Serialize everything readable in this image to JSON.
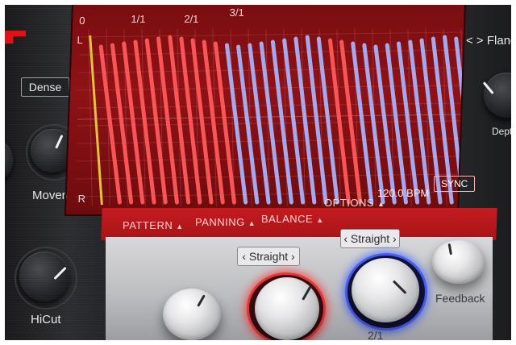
{
  "display": {
    "time_markers": [
      "0",
      "1/1",
      "2/1",
      "3/1"
    ],
    "channel_left": "L",
    "channel_right": "R",
    "colors": {
      "bar_red": "#ff5a5a",
      "bar_blue": "#a9b6ff",
      "playhead": "#e6c23a"
    }
  },
  "left_panel": {
    "mode": "Dense",
    "movement_label": "Movement",
    "hicut_label": "HiCut"
  },
  "right_panel": {
    "nav_icon": "< >",
    "title": "Flang",
    "depth_label": "Dept"
  },
  "tabs": [
    "PATTERN",
    "PANNING",
    "BALANCE",
    "OPTIONS"
  ],
  "tab_arrow": "▲",
  "tempo": "120.0 BPM",
  "sync_label": "SYNC",
  "bottom": {
    "selector_left": "Straight",
    "selector_right": "Straight",
    "nav_left": "‹",
    "nav_right": "›",
    "division_label": "2/1",
    "feedback_label": "Feedback"
  }
}
